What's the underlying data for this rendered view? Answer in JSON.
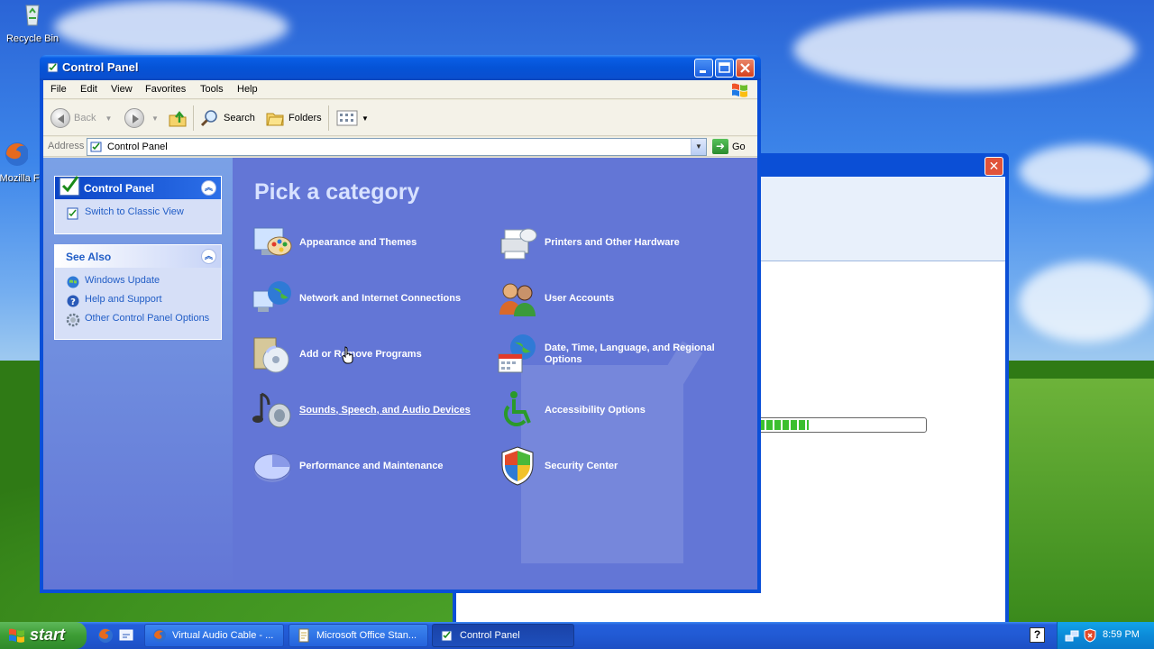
{
  "desktop": {
    "icons": [
      {
        "label": "Recycle Bin"
      },
      {
        "label": "Mozilla Fi"
      }
    ]
  },
  "window": {
    "title": "Control Panel",
    "menu": [
      "File",
      "Edit",
      "View",
      "Favorites",
      "Tools",
      "Help"
    ],
    "toolbar": {
      "back": "Back",
      "search": "Search",
      "folders": "Folders"
    },
    "address": {
      "label": "Address",
      "value": "Control Panel",
      "go": "Go"
    },
    "taskpane": {
      "control_panel": {
        "title": "Control Panel",
        "items": [
          {
            "label": "Switch to Classic View",
            "icon": "classic-view-icon"
          }
        ]
      },
      "see_also": {
        "title": "See Also",
        "items": [
          {
            "label": "Windows Update",
            "icon": "windows-update-icon"
          },
          {
            "label": "Help and Support",
            "icon": "help-icon"
          },
          {
            "label": "Other Control Panel Options",
            "icon": "gear-icon"
          }
        ]
      }
    },
    "main": {
      "heading": "Pick a category",
      "categories": [
        {
          "label": "Appearance and Themes",
          "icon": "appearance-themes-icon"
        },
        {
          "label": "Printers and Other Hardware",
          "icon": "printer-icon"
        },
        {
          "label": "Network and Internet Connections",
          "icon": "network-globe-icon"
        },
        {
          "label": "User Accounts",
          "icon": "user-accounts-icon"
        },
        {
          "label": "Add or Remove Programs",
          "icon": "add-remove-programs-icon"
        },
        {
          "label": "Date, Time, Language, and Regional Options",
          "icon": "date-time-globe-icon"
        },
        {
          "label": "Sounds, Speech, and Audio Devices",
          "icon": "sound-icon"
        },
        {
          "label": "Accessibility Options",
          "icon": "accessibility-icon"
        },
        {
          "label": "Performance and Maintenance",
          "icon": "performance-pie-icon"
        },
        {
          "label": "Security Center",
          "icon": "security-shield-icon"
        }
      ]
    }
  },
  "taskbar": {
    "start": "start",
    "tasks": [
      {
        "label": "Virtual Audio Cable - ...",
        "icon": "firefox-icon",
        "active": false
      },
      {
        "label": "Microsoft Office Stan...",
        "icon": "office-setup-icon",
        "active": false
      },
      {
        "label": "Control Panel",
        "icon": "control-panel-icon",
        "active": true
      }
    ],
    "help": "?",
    "clock": "8:59 PM"
  },
  "colors": {
    "xp_blue": "#0a4fd8",
    "taskpane_blue": "#6376d6",
    "link_blue": "#215dc6",
    "start_green": "#3c9c34"
  }
}
